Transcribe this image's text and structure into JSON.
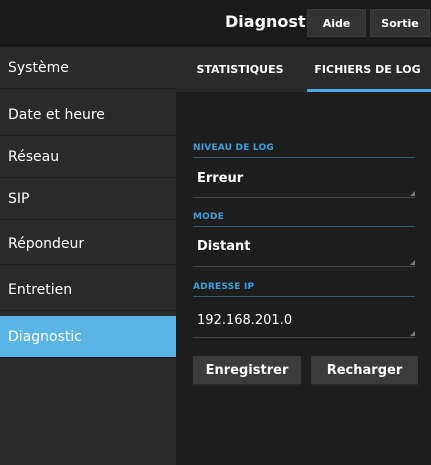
{
  "header": {
    "title": "Diagnostic",
    "help_label": "Aide",
    "exit_label": "Sortie"
  },
  "sidebar": {
    "items": [
      {
        "label": "Système"
      },
      {
        "label": "Date et heure"
      },
      {
        "label": "Réseau"
      },
      {
        "label": "SIP"
      },
      {
        "label": "Répondeur"
      },
      {
        "label": "Entretien"
      },
      {
        "label": "Diagnostic"
      }
    ],
    "active": "Diagnostic"
  },
  "tabs": [
    {
      "label": "STATISTIQUES"
    },
    {
      "label": "FICHIERS DE LOG"
    }
  ],
  "form": {
    "log_level": {
      "label": "NIVEAU DE LOG",
      "value": "Erreur"
    },
    "mode": {
      "label": "MODE",
      "value": "Distant"
    },
    "ip": {
      "label": "ADRESSE IP",
      "value": "192.168.201.0"
    }
  },
  "actions": {
    "save_label": "Enregistrer",
    "reload_label": "Recharger"
  },
  "colors": {
    "accent": "#5ab4e5",
    "label_blue": "#3ba0dd"
  }
}
